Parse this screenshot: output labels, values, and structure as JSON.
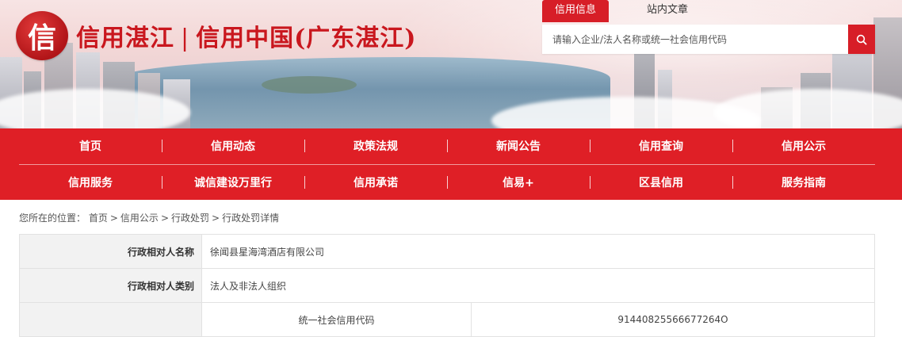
{
  "header": {
    "logo_char": "信",
    "site_title_left": "信用湛江",
    "site_title_sep": "|",
    "site_title_right": "信用中国(广东湛江)"
  },
  "search": {
    "tabs": [
      {
        "label": "信用信息",
        "active": true
      },
      {
        "label": "站内文章",
        "active": false
      }
    ],
    "placeholder": "请输入企业/法人名称或统一社会信用代码",
    "button_icon": "search-icon"
  },
  "nav": {
    "row1": [
      "首页",
      "信用动态",
      "政策法规",
      "新闻公告",
      "信用查询",
      "信用公示"
    ],
    "row2": [
      "信用服务",
      "诚信建设万里行",
      "信用承诺",
      "信易+",
      "区县信用",
      "服务指南"
    ]
  },
  "breadcrumb": {
    "prefix": "您所在的位置：",
    "items": [
      "首页",
      "信用公示",
      "行政处罚",
      "行政处罚详情"
    ],
    "separator": ">"
  },
  "detail": {
    "rows": [
      {
        "label": "行政相对人名称",
        "value": "徐闻县星海湾酒店有限公司"
      },
      {
        "label": "行政相对人类别",
        "value": "法人及非法人组织"
      }
    ],
    "sub_row": {
      "label": "统一社会信用代码",
      "value": "91440825566677264O"
    }
  },
  "colors": {
    "brand_red": "#df1f26",
    "title_red": "#c9171e",
    "label_bg": "#f2f2f2"
  }
}
